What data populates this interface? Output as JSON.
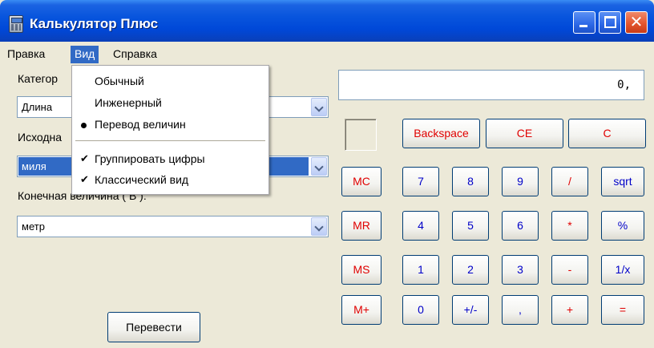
{
  "window": {
    "title": "Калькулятор Плюс",
    "close_glyph": "✕"
  },
  "menubar": {
    "items": [
      "Правка",
      "Вид",
      "Справка"
    ],
    "active": "Вид"
  },
  "view_menu": {
    "items": [
      {
        "label": "Обычный",
        "mark": ""
      },
      {
        "label": "Инженерный",
        "mark": ""
      },
      {
        "label": "Перевод величин",
        "mark": "radio"
      },
      {
        "label": "Группировать цифры",
        "mark": "check"
      },
      {
        "label": "Классический вид",
        "mark": "check"
      }
    ],
    "check_glyph": "✔"
  },
  "converter": {
    "category_label": "Категор",
    "category_value": "Длина",
    "source_label": "Исходна",
    "source_value": "миля",
    "target_label": "Конечная величина ( В ):",
    "target_value": "метр",
    "convert_button": "Перевести"
  },
  "calculator": {
    "display_value": "0,",
    "top_row": [
      "Backspace",
      "CE",
      "C"
    ],
    "memory": [
      "MC",
      "MR",
      "MS",
      "M+"
    ],
    "keys": [
      [
        "7",
        "8",
        "9",
        "/",
        "sqrt"
      ],
      [
        "4",
        "5",
        "6",
        "*",
        "%"
      ],
      [
        "1",
        "2",
        "3",
        "-",
        "1/x"
      ],
      [
        "0",
        "+/-",
        ",",
        "+",
        "="
      ]
    ]
  }
}
